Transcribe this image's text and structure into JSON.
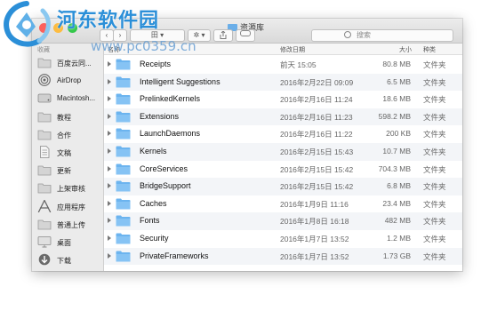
{
  "watermark": {
    "title": "河东软件园",
    "url": "www.pc0359.cn"
  },
  "window": {
    "title": "资源库"
  },
  "toolbar": {
    "view_label": "田 ▾",
    "action_label": "✲ ▾",
    "search_placeholder": "搜索"
  },
  "sidebar": {
    "header": "收藏",
    "items": [
      {
        "label": "百度云同...",
        "icon": "folder-icon"
      },
      {
        "label": "AirDrop",
        "icon": "airdrop-icon"
      },
      {
        "label": "Macintosh...",
        "icon": "hard-disk-icon"
      },
      {
        "label": "教程",
        "icon": "folder-icon"
      },
      {
        "label": "合作",
        "icon": "folder-icon"
      },
      {
        "label": "文稿",
        "icon": "document-icon"
      },
      {
        "label": "更新",
        "icon": "folder-icon"
      },
      {
        "label": "上架审核",
        "icon": "folder-icon"
      },
      {
        "label": "应用程序",
        "icon": "applications-icon"
      },
      {
        "label": "普通上传",
        "icon": "folder-icon"
      },
      {
        "label": "桌面",
        "icon": "desktop-icon"
      },
      {
        "label": "下载",
        "icon": "downloads-icon"
      }
    ]
  },
  "columns": {
    "name": "名称",
    "date": "修改日期",
    "size": "大小",
    "kind": "种类"
  },
  "files": [
    {
      "name": "Receipts",
      "date": "前天 15:05",
      "size": "80.8 MB",
      "kind": "文件夹"
    },
    {
      "name": "Intelligent Suggestions",
      "date": "2016年2月22日 09:09",
      "size": "6.5 MB",
      "kind": "文件夹"
    },
    {
      "name": "PrelinkedKernels",
      "date": "2016年2月16日 11:24",
      "size": "18.6 MB",
      "kind": "文件夹"
    },
    {
      "name": "Extensions",
      "date": "2016年2月16日 11:23",
      "size": "598.2 MB",
      "kind": "文件夹"
    },
    {
      "name": "LaunchDaemons",
      "date": "2016年2月16日 11:22",
      "size": "200 KB",
      "kind": "文件夹"
    },
    {
      "name": "Kernels",
      "date": "2016年2月15日 15:43",
      "size": "10.7 MB",
      "kind": "文件夹"
    },
    {
      "name": "CoreServices",
      "date": "2016年2月15日 15:42",
      "size": "704.3 MB",
      "kind": "文件夹"
    },
    {
      "name": "BridgeSupport",
      "date": "2016年2月15日 15:42",
      "size": "6.8 MB",
      "kind": "文件夹"
    },
    {
      "name": "Caches",
      "date": "2016年1月9日 11:16",
      "size": "23.4 MB",
      "kind": "文件夹"
    },
    {
      "name": "Fonts",
      "date": "2016年1月8日 16:18",
      "size": "482 MB",
      "kind": "文件夹"
    },
    {
      "name": "Security",
      "date": "2016年1月7日 13:52",
      "size": "1.2 MB",
      "kind": "文件夹"
    },
    {
      "name": "PrivateFrameworks",
      "date": "2016年1月7日 13:52",
      "size": "1.73 GB",
      "kind": "文件夹"
    }
  ],
  "colors": {
    "folder_blue": "#6cb4ef",
    "sidebar_bg": "#ebebeb",
    "accent": "#2b8fd8"
  }
}
